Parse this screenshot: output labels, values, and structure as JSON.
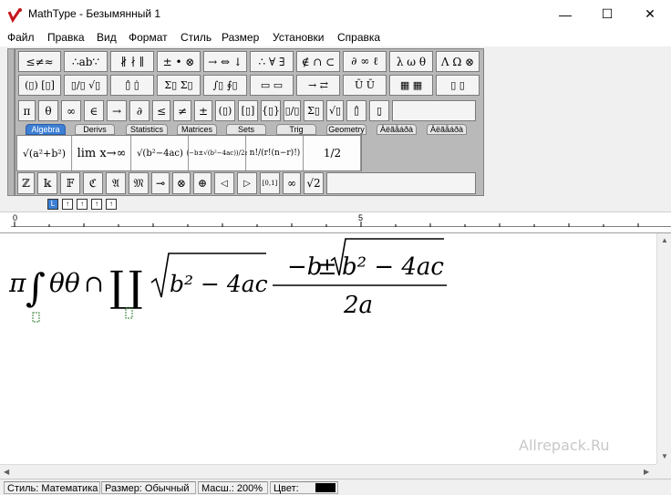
{
  "window": {
    "title": "MathType - Безымянный 1",
    "minimize_glyph": "—",
    "maximize_glyph": "☐",
    "close_glyph": "✕"
  },
  "menu": [
    "Файл",
    "Правка",
    "Вид",
    "Формат",
    "Стиль",
    "Размер",
    "Установки",
    "Справка"
  ],
  "palette_row1": [
    "≤≠≈",
    "∴ab∵",
    "∦ ∤ ∥",
    "± • ⊗",
    "→ ⇔ ↓",
    "∴ ∀ ∃",
    "∉ ∩ ⊂",
    "∂ ∞ ℓ",
    "λ ω θ",
    "Λ Ω ⊗"
  ],
  "palette_row2": [
    "(▯) [▯]",
    "▯/▯ √▯",
    "▯̂ ▯̇",
    "Σ▯ Σ▯",
    "∫▯ ∮▯",
    "▭ ▭",
    "→ ⇄",
    "Ū Ū",
    "▦ ▦",
    "▯ ▯"
  ],
  "palette_row3": [
    "π",
    "θ",
    "∞",
    "∈",
    "→",
    "∂",
    "≤",
    "≠",
    "±",
    "(▯)",
    "[▯]",
    "{▯}",
    "▯/▯",
    "Σ▯",
    "√▯",
    "▯̂",
    "▯̣"
  ],
  "tabs": [
    "Algebra",
    "Derivs",
    "Statistics",
    "Matrices",
    "Sets",
    "Trig",
    "Geometry",
    "Àëãåáðà",
    "Àëãåáðà"
  ],
  "algebra_templates": [
    "√(a²+b²)",
    "lim x→∞",
    "√(b²−4ac)",
    "(−b±√(b²−4ac))/2a",
    "n!/(r!(n−r)!)",
    "1/2"
  ],
  "symbol_row": [
    "ℤ",
    "𝕜",
    "𝔽",
    "ℭ",
    "𝔄",
    "𝔐",
    "⊸",
    "⊗",
    "⊕",
    "◁",
    "▷",
    "[0,1]",
    "∞",
    "√2"
  ],
  "small_buttons": [
    "L",
    "↑",
    "↑",
    "↑",
    "↑"
  ],
  "ruler": {
    "label_start": "0",
    "label_mid": "5"
  },
  "formula": {
    "pi": "π",
    "integral": "∫",
    "theta_theta": "θθ",
    "cap": "∩",
    "coproduct": "∐",
    "radical_body": "b² − 4ac",
    "numerator_minus_b": "−b",
    "pm": "±",
    "denominator": "2a"
  },
  "watermark": "Allrepack.Ru",
  "status": {
    "style": "Стиль: Математика",
    "size": "Размер: Обычный",
    "zoom": "Масш.: 200%",
    "color_label": "Цвет:",
    "color_value": "#000000"
  }
}
